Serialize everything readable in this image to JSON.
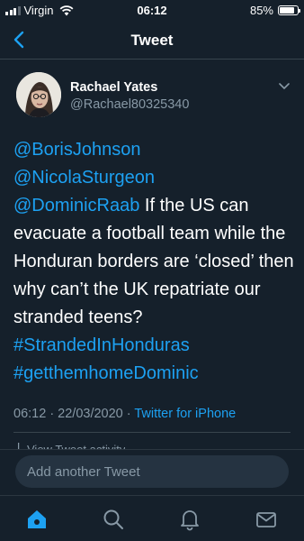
{
  "status_bar": {
    "carrier": "Virgin",
    "time": "06:12",
    "battery_text": "85%",
    "battery_level": 0.85,
    "signal_bars_active": 3
  },
  "nav": {
    "title": "Tweet",
    "back_icon": "chevron-left-icon"
  },
  "tweet": {
    "author_name": "Rachael Yates",
    "author_handle": "@Rachael80325340",
    "mention_1": "@BorisJohnson",
    "mention_2": "@NicolaSturgeon",
    "mention_3": "@DominicRaab",
    "text_line_3_rest": " If the US can",
    "text_body": "evacuate a football team while the Honduran borders are ‘closed’ then why can’t the UK repatriate our stranded teens?",
    "hashtag_1": "#StrandedInHonduras",
    "hashtag_2": "#getthemhomeDominic",
    "timestamp": "06:12 · 22/03/2020 · ",
    "source": "Twitter for iPhone",
    "activity_label": "View Tweet activity"
  },
  "reply": {
    "placeholder": "Add another Tweet"
  },
  "tabs": [
    {
      "name": "home",
      "icon": "home-icon",
      "active": true
    },
    {
      "name": "search",
      "icon": "search-icon",
      "active": false
    },
    {
      "name": "notifications",
      "icon": "bell-icon",
      "active": false
    },
    {
      "name": "messages",
      "icon": "mail-icon",
      "active": false
    }
  ],
  "colors": {
    "background": "#15202b",
    "accent": "#1da1f2",
    "secondary_text": "#8899a6",
    "divider": "#38444d"
  }
}
